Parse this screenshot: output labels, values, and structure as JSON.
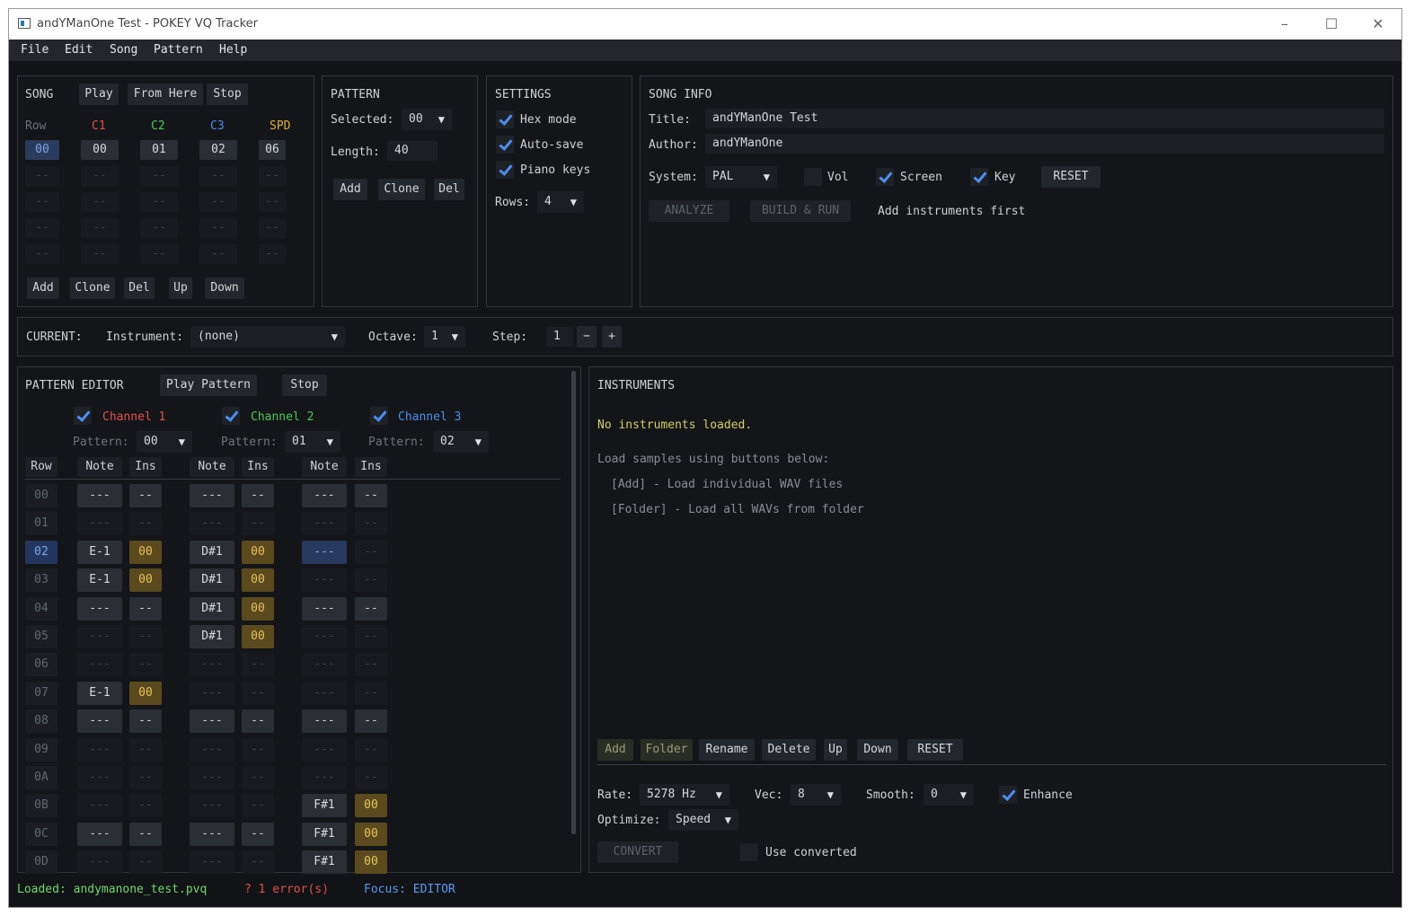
{
  "window": {
    "title": "andYManOne Test - POKEY VQ Tracker",
    "minimize": "–",
    "maximize": "☐",
    "close": "✕"
  },
  "menu": [
    "File",
    "Edit",
    "Song",
    "Pattern",
    "Help"
  ],
  "song": {
    "title": "SONG",
    "play": "Play",
    "from_here": "From Here",
    "stop": "Stop",
    "headers": [
      "Row",
      "C1",
      "C2",
      "C3",
      "SPD"
    ],
    "header_colors": [
      "#6f737a",
      "#e05050",
      "#4cc85a",
      "#4a8ef0",
      "#d9b040"
    ],
    "rows": [
      [
        "00",
        "00",
        "01",
        "02",
        "06"
      ],
      [
        "--",
        "--",
        "--",
        "--",
        "--"
      ],
      [
        "--",
        "--",
        "--",
        "--",
        "--"
      ],
      [
        "--",
        "--",
        "--",
        "--",
        "--"
      ],
      [
        "--",
        "--",
        "--",
        "--",
        "--"
      ]
    ],
    "buttons": [
      "Add",
      "Clone",
      "Del",
      "Up",
      "Down"
    ]
  },
  "pattern": {
    "title": "PATTERN",
    "selected_label": "Selected:",
    "selected_value": "00",
    "length_label": "Length:",
    "length_value": "40",
    "buttons": [
      "Add",
      "Clone",
      "Del"
    ]
  },
  "settings": {
    "title": "SETTINGS",
    "hex_mode": "Hex mode",
    "auto_save": "Auto-save",
    "piano_keys": "Piano keys",
    "rows_label": "Rows:",
    "rows_value": "4"
  },
  "song_info": {
    "title": "SONG INFO",
    "title_label": "Title:",
    "title_value": "andYManOne Test",
    "author_label": "Author:",
    "author_value": "andYManOne",
    "system_label": "System:",
    "system_value": "PAL",
    "vol": "Vol",
    "screen": "Screen",
    "key": "Key",
    "reset": "RESET",
    "analyze": "ANALYZE",
    "build_run": "BUILD & RUN",
    "hint": "Add instruments first"
  },
  "current": {
    "label": "CURRENT:",
    "instrument_label": "Instrument:",
    "instrument_value": "(none)",
    "octave_label": "Octave:",
    "octave_value": "1",
    "step_label": "Step:",
    "step_value": "1",
    "minus": "−",
    "plus": "+"
  },
  "pattern_editor": {
    "title": "PATTERN EDITOR",
    "play_pattern": "Play Pattern",
    "stop": "Stop",
    "channels": [
      {
        "name": "Channel 1",
        "color": "#e05050",
        "pattern_label": "Pattern:",
        "pattern_value": "00"
      },
      {
        "name": "Channel 2",
        "color": "#4cc85a",
        "pattern_label": "Pattern:",
        "pattern_value": "01"
      },
      {
        "name": "Channel 3",
        "color": "#4a8ef0",
        "pattern_label": "Pattern:",
        "pattern_value": "02"
      }
    ],
    "col_headers": [
      "Row",
      "Note",
      "Ins",
      "Note",
      "Ins",
      "Note",
      "Ins"
    ],
    "rows": [
      {
        "row": "00",
        "cells": [
          "---",
          "--",
          "---",
          "--",
          "---",
          "--"
        ]
      },
      {
        "row": "01",
        "cells": [
          "---",
          "--",
          "---",
          "--",
          "---",
          "--"
        ]
      },
      {
        "row": "02",
        "cells": [
          "E-1",
          "00",
          "D#1",
          "00",
          "---",
          "--"
        ]
      },
      {
        "row": "03",
        "cells": [
          "E-1",
          "00",
          "D#1",
          "00",
          "---",
          "--"
        ]
      },
      {
        "row": "04",
        "cells": [
          "---",
          "--",
          "D#1",
          "00",
          "---",
          "--"
        ]
      },
      {
        "row": "05",
        "cells": [
          "---",
          "--",
          "D#1",
          "00",
          "---",
          "--"
        ]
      },
      {
        "row": "06",
        "cells": [
          "---",
          "--",
          "---",
          "--",
          "---",
          "--"
        ]
      },
      {
        "row": "07",
        "cells": [
          "E-1",
          "00",
          "---",
          "--",
          "---",
          "--"
        ]
      },
      {
        "row": "08",
        "cells": [
          "---",
          "--",
          "---",
          "--",
          "---",
          "--"
        ]
      },
      {
        "row": "09",
        "cells": [
          "---",
          "--",
          "---",
          "--",
          "---",
          "--"
        ]
      },
      {
        "row": "0A",
        "cells": [
          "---",
          "--",
          "---",
          "--",
          "---",
          "--"
        ]
      },
      {
        "row": "0B",
        "cells": [
          "---",
          "--",
          "---",
          "--",
          "F#1",
          "00"
        ]
      },
      {
        "row": "0C",
        "cells": [
          "---",
          "--",
          "---",
          "--",
          "F#1",
          "00"
        ]
      },
      {
        "row": "0D",
        "cells": [
          "---",
          "--",
          "---",
          "--",
          "F#1",
          "00"
        ]
      }
    ]
  },
  "instruments": {
    "title": "INSTRUMENTS",
    "empty": "No instruments loaded.",
    "hint1": "Load samples using buttons below:",
    "hint2": "[Add] - Load individual WAV files",
    "hint3": "[Folder] - Load all WAVs from folder",
    "buttons": [
      "Add",
      "Folder",
      "Rename",
      "Delete",
      "Up",
      "Down",
      "RESET"
    ],
    "rate_label": "Rate:",
    "rate_value": "5278 Hz",
    "vec_label": "Vec:",
    "vec_value": "8",
    "smooth_label": "Smooth:",
    "smooth_value": "0",
    "enhance": "Enhance",
    "optimize_label": "Optimize:",
    "optimize_value": "Speed",
    "convert": "CONVERT",
    "use_converted": "Use converted"
  },
  "status": {
    "loaded": "Loaded: andymanone_test.pvq",
    "errors": "? 1 error(s)",
    "focus": "Focus: EDITOR",
    "loaded_color": "#6fd86f",
    "error_color": "#e05050",
    "focus_color": "#5a9af0"
  }
}
